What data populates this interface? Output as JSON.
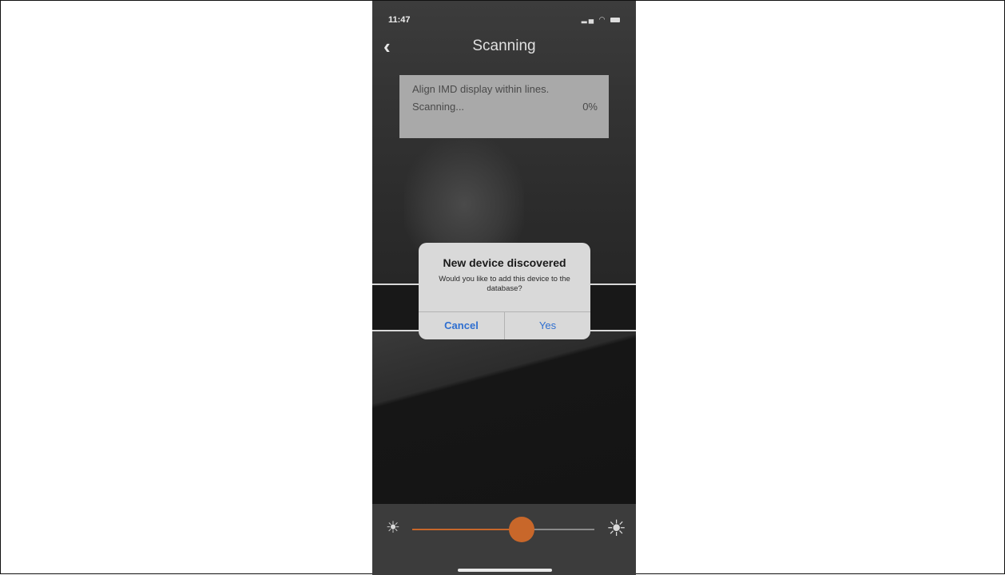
{
  "status_bar": {
    "time": "11:47",
    "signal_icon": "signal-icon",
    "wifi_icon": "wifi-icon",
    "battery_icon": "battery-icon"
  },
  "nav": {
    "back_icon": "chevron-left-icon",
    "back_glyph": "‹",
    "title": "Scanning"
  },
  "scan_info": {
    "instruction": "Align IMD display within lines.",
    "status": "Scanning...",
    "progress": "0%"
  },
  "dialog": {
    "title": "New device discovered",
    "message": "Would you like to add this device to the database?",
    "cancel_label": "Cancel",
    "yes_label": "Yes"
  },
  "brightness": {
    "min_icon": "sun-small-icon",
    "max_icon": "sun-large-icon",
    "min_glyph": "☀",
    "max_glyph": "☀",
    "level": 0.6
  },
  "colors": {
    "accent": "#c8672a",
    "dialog_button": "#2f6fd0"
  }
}
